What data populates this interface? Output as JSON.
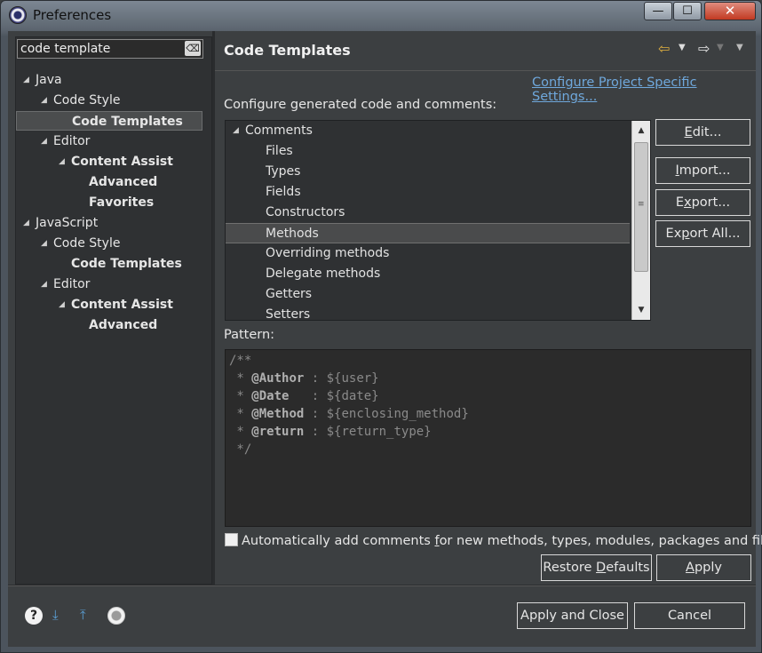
{
  "window": {
    "title": "Preferences",
    "minimize": "—",
    "maximize": "☐",
    "close": "✕"
  },
  "filter": {
    "value": "code template",
    "clear_glyph": "⌫"
  },
  "tree": [
    {
      "label": "Java",
      "twisty": "◢",
      "bold": false
    },
    {
      "label": "Code Style",
      "twisty": "◢",
      "bold": false
    },
    {
      "label": "Code Templates",
      "twisty": "",
      "bold": true,
      "selected": true
    },
    {
      "label": "Editor",
      "twisty": "◢",
      "bold": false
    },
    {
      "label": "Content Assist",
      "twisty": "◢",
      "bold": true
    },
    {
      "label": "Advanced",
      "twisty": "",
      "bold": true
    },
    {
      "label": "Favorites",
      "twisty": "",
      "bold": true
    },
    {
      "label": "JavaScript",
      "twisty": "◢",
      "bold": false
    },
    {
      "label": "Code Style",
      "twisty": "◢",
      "bold": false
    },
    {
      "label": "Code Templates",
      "twisty": "",
      "bold": true
    },
    {
      "label": "Editor",
      "twisty": "◢",
      "bold": false
    },
    {
      "label": "Content Assist",
      "twisty": "◢",
      "bold": true
    },
    {
      "label": "Advanced",
      "twisty": "",
      "bold": true
    }
  ],
  "page": {
    "title": "Code Templates",
    "nav": {
      "back": "⇦",
      "forward": "⇨",
      "dropdown": "▼"
    },
    "config_link": "Configure Project Specific Settings...",
    "config_label": "Configure generated code and comments:"
  },
  "templates": {
    "group": "Comments",
    "group_twisty": "◢",
    "items": [
      "Files",
      "Types",
      "Fields",
      "Constructors",
      "Methods",
      "Overriding methods",
      "Delegate methods",
      "Getters",
      "Setters"
    ],
    "selected": "Methods"
  },
  "side_buttons": {
    "edit": {
      "pre": "",
      "u": "E",
      "post": "dit..."
    },
    "import": {
      "pre": "",
      "u": "I",
      "post": "mport..."
    },
    "export": {
      "pre": "E",
      "u": "x",
      "post": "port..."
    },
    "export_all": {
      "pre": "Ex",
      "u": "p",
      "post": "ort All..."
    }
  },
  "pattern": {
    "label": "Pattern:",
    "lines": [
      {
        "pre": "/**",
        "kw": "",
        "post": ""
      },
      {
        "pre": " * ",
        "kw": "@Author",
        "post": " : ${user}"
      },
      {
        "pre": " * ",
        "kw": "@Date",
        "post": "   : ${date}"
      },
      {
        "pre": " * ",
        "kw": "@Method",
        "post": " : ${enclosing_method}"
      },
      {
        "pre": " * ",
        "kw": "@return",
        "post": " : ${return_type}"
      },
      {
        "pre": " */",
        "kw": "",
        "post": ""
      }
    ]
  },
  "auto_comments": {
    "pre": "Automatically add comments ",
    "u": "f",
    "post": "or new methods, types, modules, packages and files",
    "checked": false
  },
  "restore_defaults": {
    "pre": "Restore ",
    "u": "D",
    "post": "efaults"
  },
  "apply": {
    "pre": "",
    "u": "A",
    "post": "pply"
  },
  "apply_close": "Apply and Close",
  "cancel": "Cancel",
  "footer_icons": [
    "help-icon",
    "import-icon",
    "export-icon",
    "record-icon"
  ]
}
